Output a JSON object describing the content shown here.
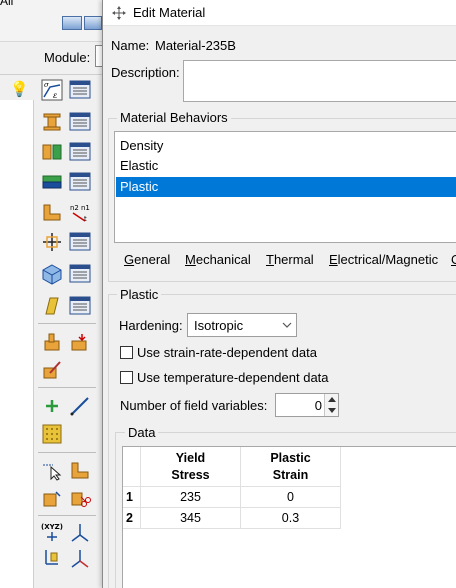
{
  "background_app": {
    "menu_text": "All",
    "module_label": "Module:"
  },
  "dialog": {
    "title": "Edit Material",
    "name_label": "Name:",
    "name_value": "Material-235B",
    "description_label": "Description:",
    "description_value": "",
    "behaviors": {
      "title": "Material Behaviors",
      "items": [
        "Density",
        "Elastic",
        "Plastic"
      ],
      "selected": "Plastic"
    },
    "menus": [
      {
        "label": "General",
        "mnemonic": "G",
        "rest": "eneral"
      },
      {
        "label": "Mechanical",
        "mnemonic": "M",
        "rest": "echanical"
      },
      {
        "label": "Thermal",
        "mnemonic": "T",
        "rest": "hermal"
      },
      {
        "label": "Electrical/Magnetic",
        "mnemonic": "E",
        "rest": "lectrical/Magnetic"
      },
      {
        "label": "Other",
        "mnemonic": "O",
        "rest": ""
      }
    ],
    "plastic": {
      "title": "Plastic",
      "hardening_label": "Hardening:",
      "hardening_value": "Isotropic",
      "strain_rate_label": "Use strain-rate-dependent data",
      "strain_rate_checked": false,
      "temperature_label": "Use temperature-dependent data",
      "temperature_checked": false,
      "field_vars_label": "Number of field variables:",
      "field_vars_value": "0"
    },
    "data": {
      "title": "Data",
      "columns": [
        {
          "line1": "Yield",
          "line2": "Stress"
        },
        {
          "line1": "Plastic",
          "line2": "Strain"
        }
      ],
      "rows": [
        {
          "index": "1",
          "values": [
            "235",
            "0"
          ]
        },
        {
          "index": "2",
          "values": [
            "345",
            "0.3"
          ]
        }
      ]
    }
  },
  "colors": {
    "selection": "#0078d7",
    "window_bg": "#f0f0f0"
  }
}
